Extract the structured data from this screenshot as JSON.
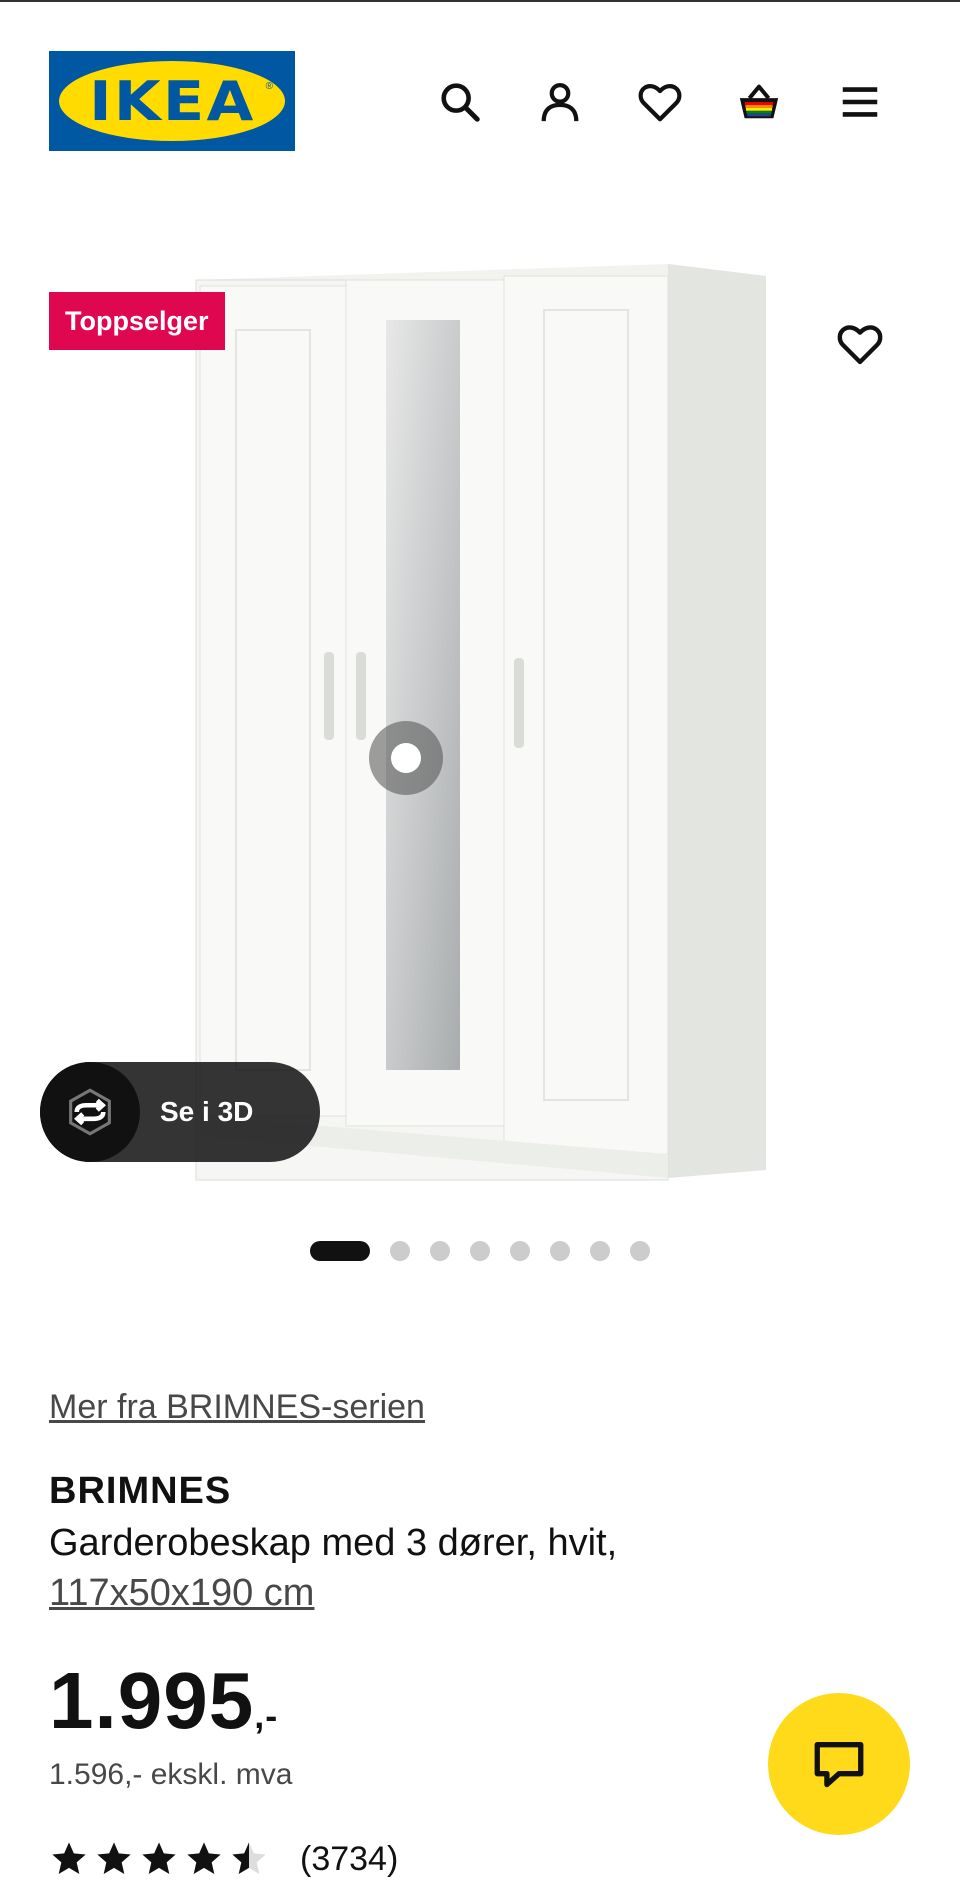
{
  "header": {
    "logo_text": "IKEA",
    "logo_reg": "®",
    "icons": [
      "search-icon",
      "account-icon",
      "heart-icon",
      "basket-icon",
      "menu-icon"
    ]
  },
  "gallery": {
    "badge": "Toppselger",
    "view_3d_label": "Se i 3D",
    "slide_count": 8,
    "active_slide": 1
  },
  "product": {
    "series_link": "Mer fra BRIMNES-serien",
    "name": "BRIMNES",
    "description": "Garderobeskap med 3 dører, hvit,",
    "dimensions": "117x50x190 cm",
    "price": "1.995",
    "price_suffix": ",-",
    "price_ex_vat": "1.596,- ekskl. mva",
    "rating": 4.5,
    "review_count": "(3734)"
  },
  "colors": {
    "brand_blue": "#0058a3",
    "brand_yellow": "#ffdb00",
    "badge_red": "#e00751",
    "chat_yellow": "#ffda1a"
  }
}
